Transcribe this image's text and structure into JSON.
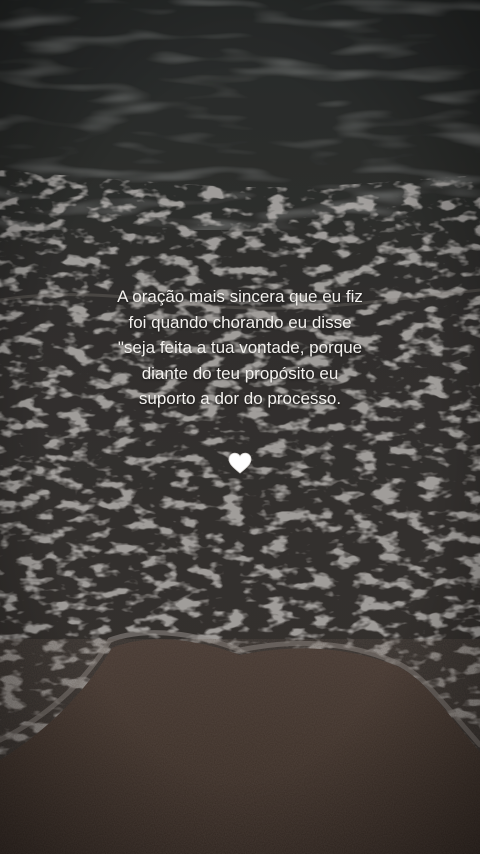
{
  "quote": {
    "lines": [
      "A oração mais sincera que eu fiz",
      "foi quando chorando eu disse",
      "\"seja feita a tua vontade, porque",
      "diante do teu propósito eu",
      "suporto a dor do processo."
    ]
  },
  "emoji": {
    "icon": "white-heart-icon",
    "color": "#ffffff"
  },
  "colors": {
    "sea": "#2e302f",
    "foam": "#8a8580",
    "sand": "#4a3a30",
    "text": "#f4f2ef"
  }
}
